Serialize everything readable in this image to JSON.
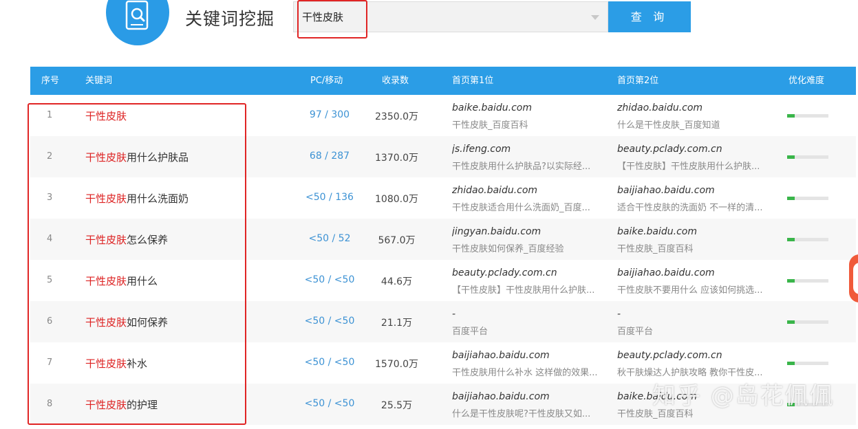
{
  "app": {
    "title": "关键词挖掘"
  },
  "search": {
    "value": "干性皮肤",
    "button_label": "查 询"
  },
  "table": {
    "headers": [
      "序号",
      "关键词",
      "PC/移动",
      "收录数",
      "首页第1位",
      "首页第2位",
      "优化难度"
    ],
    "rows": [
      {
        "idx": "1",
        "kw_hl": "干性皮肤",
        "kw_rest": "",
        "pm": "97 / 300",
        "count": "2350.0万",
        "site1": "baike.baidu.com",
        "snip1": "干性皮肤_百度百科",
        "site2": "zhidao.baidu.com",
        "snip2": "什么是干性皮肤_百度知道",
        "difficulty": 0.18
      },
      {
        "idx": "2",
        "kw_hl": "干性皮肤",
        "kw_rest": "用什么护肤品",
        "pm": "68 / 287",
        "count": "1370.0万",
        "site1": "js.ifeng.com",
        "snip1": "干性皮肤用什么护肤品?以实际经...",
        "site2": "beauty.pclady.com.cn",
        "snip2": "【干性皮肤】干性皮肤用什么护肤...",
        "difficulty": 0.18
      },
      {
        "idx": "3",
        "kw_hl": "干性皮肤",
        "kw_rest": "用什么洗面奶",
        "pm": "<50 / 136",
        "count": "1080.0万",
        "site1": "zhidao.baidu.com",
        "snip1": "干性皮肤适合用什么洗面奶_百度...",
        "site2": "baijiahao.baidu.com",
        "snip2": "适合干性皮肤的洗面奶 不一样的清...",
        "difficulty": 0.18
      },
      {
        "idx": "4",
        "kw_hl": "干性皮肤",
        "kw_rest": "怎么保养",
        "pm": "<50 / 52",
        "count": "567.0万",
        "site1": "jingyan.baidu.com",
        "snip1": "干性皮肤如何保养_百度经验",
        "site2": "baike.baidu.com",
        "snip2": "干性皮肤_百度百科",
        "difficulty": 0.18
      },
      {
        "idx": "5",
        "kw_hl": "干性皮肤",
        "kw_rest": "用什么",
        "pm": "<50 / <50",
        "count": "44.6万",
        "site1": "beauty.pclady.com.cn",
        "snip1": "【干性皮肤】干性皮肤用什么护肤...",
        "site2": "baijiahao.baidu.com",
        "snip2": "干性皮肤不要用什么 应该如何挑选...",
        "difficulty": 0.18
      },
      {
        "idx": "6",
        "kw_hl": "干性皮肤",
        "kw_rest": "如何保养",
        "pm": "<50 / <50",
        "count": "21.1万",
        "site1": "-",
        "snip1": "百度平台",
        "site2": "-",
        "snip2": "百度平台",
        "difficulty": 0.18
      },
      {
        "idx": "7",
        "kw_hl": "干性皮肤",
        "kw_rest": "补水",
        "pm": "<50 / <50",
        "count": "1570.0万",
        "site1": "baijiahao.baidu.com",
        "snip1": "干性皮肤用什么补水 这样做的效果...",
        "site2": "beauty.pclady.com.cn",
        "snip2": "秋干肤燥达人护肤攻略 教你干性皮...",
        "difficulty": 0.18
      },
      {
        "idx": "8",
        "kw_hl": "干性皮肤",
        "kw_rest": "的护理",
        "pm": "<50 / <50",
        "count": "25.5万",
        "site1": "baijiahao.baidu.com",
        "snip1": "什么是干性皮肤呢?干性皮肤又如...",
        "site2": "baike.baidu.com",
        "snip2": "干性皮肤_百度百科",
        "difficulty": 0.18
      }
    ]
  },
  "watermark": "知乎 @岛花佩佩",
  "colors": {
    "accent": "#2b9de6",
    "highlight": "#e02424",
    "keyword": "#dd2222",
    "difficulty_bar": "#3ab54a"
  },
  "icons": {
    "logo": "search-document-icon",
    "dropdown": "chevron-down-icon"
  }
}
